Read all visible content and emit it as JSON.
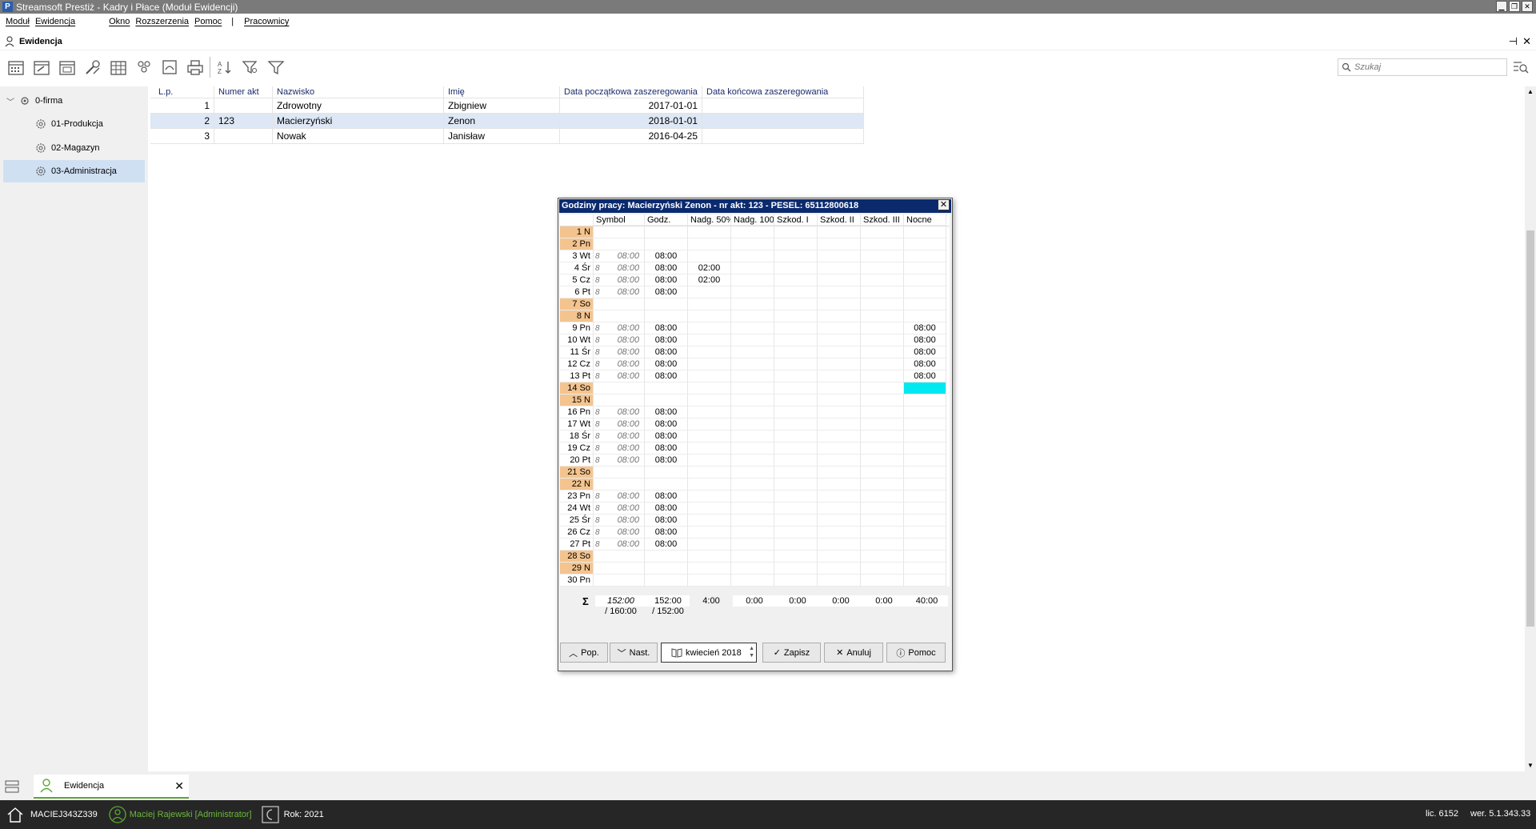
{
  "window": {
    "title": "Streamsoft Prestiż - Kadry i Płace (Moduł Ewidencji)",
    "app_icon": "P"
  },
  "menu": [
    "Moduł",
    "Ewidencja",
    "Okno",
    "Rozszerzenia",
    "Pomoc",
    "|",
    "Pracownicy"
  ],
  "section": {
    "title": "Ewidencja"
  },
  "search": {
    "placeholder": "Szukaj"
  },
  "tree": [
    {
      "label": "0-firma"
    },
    {
      "label": "01-Produkcja"
    },
    {
      "label": "02-Magazyn"
    },
    {
      "label": "03-Administracja",
      "selected": true
    }
  ],
  "grid": {
    "columns": [
      "L.p.",
      "Numer akt",
      "Nazwisko",
      "Imię",
      "Data początkowa zaszeregowania",
      "Data końcowa zaszeregowania"
    ],
    "rows": [
      {
        "lp": "1",
        "akt": "",
        "nazwisko": "Zdrowotny",
        "imie": "Zbigniew",
        "dp": "2017-01-01",
        "dk": ""
      },
      {
        "lp": "2",
        "akt": "123",
        "nazwisko": "Macierzyński",
        "imie": "Zenon",
        "dp": "2018-01-01",
        "dk": ""
      },
      {
        "lp": "3",
        "akt": "",
        "nazwisko": "Nowak",
        "imie": "Janisław",
        "dp": "2016-04-25",
        "dk": ""
      }
    ]
  },
  "dialog": {
    "title": "Godziny pracy: Macierzyński Zenon - nr akt: 123 - PESEL: 65112800618",
    "columns": [
      "Symbol",
      "Godz.",
      "Nadg. 50%",
      "Nadg. 100",
      "Szkod. I",
      "Szkod. II",
      "Szkod. III",
      "Nocne"
    ],
    "days": [
      {
        "day": "1 N",
        "weekend": true
      },
      {
        "day": "2 Pn",
        "weekend": true
      },
      {
        "day": "3 Wt",
        "sym": "8",
        "plan": "08:00",
        "godz": "08:00"
      },
      {
        "day": "4 Śr",
        "sym": "8",
        "plan": "08:00",
        "godz": "08:00",
        "n50": "02:00"
      },
      {
        "day": "5 Cz",
        "sym": "8",
        "plan": "08:00",
        "godz": "08:00",
        "n50": "02:00"
      },
      {
        "day": "6 Pt",
        "sym": "8",
        "plan": "08:00",
        "godz": "08:00"
      },
      {
        "day": "7 So",
        "weekend": true
      },
      {
        "day": "8 N",
        "weekend": true
      },
      {
        "day": "9 Pn",
        "sym": "8",
        "plan": "08:00",
        "godz": "08:00",
        "noc": "08:00"
      },
      {
        "day": "10 Wt",
        "sym": "8",
        "plan": "08:00",
        "godz": "08:00",
        "noc": "08:00"
      },
      {
        "day": "11 Śr",
        "sym": "8",
        "plan": "08:00",
        "godz": "08:00",
        "noc": "08:00"
      },
      {
        "day": "12 Cz",
        "sym": "8",
        "plan": "08:00",
        "godz": "08:00",
        "noc": "08:00"
      },
      {
        "day": "13 Pt",
        "sym": "8",
        "plan": "08:00",
        "godz": "08:00",
        "noc": "08:00"
      },
      {
        "day": "14 So",
        "weekend": true,
        "highlight_noc": true
      },
      {
        "day": "15 N",
        "weekend": true
      },
      {
        "day": "16 Pn",
        "sym": "8",
        "plan": "08:00",
        "godz": "08:00"
      },
      {
        "day": "17 Wt",
        "sym": "8",
        "plan": "08:00",
        "godz": "08:00"
      },
      {
        "day": "18 Śr",
        "sym": "8",
        "plan": "08:00",
        "godz": "08:00"
      },
      {
        "day": "19 Cz",
        "sym": "8",
        "plan": "08:00",
        "godz": "08:00"
      },
      {
        "day": "20 Pt",
        "sym": "8",
        "plan": "08:00",
        "godz": "08:00"
      },
      {
        "day": "21 So",
        "weekend": true
      },
      {
        "day": "22 N",
        "weekend": true
      },
      {
        "day": "23 Pn",
        "sym": "8",
        "plan": "08:00",
        "godz": "08:00"
      },
      {
        "day": "24 Wt",
        "sym": "8",
        "plan": "08:00",
        "godz": "08:00"
      },
      {
        "day": "25 Śr",
        "sym": "8",
        "plan": "08:00",
        "godz": "08:00"
      },
      {
        "day": "26 Cz",
        "sym": "8",
        "plan": "08:00",
        "godz": "08:00"
      },
      {
        "day": "27 Pt",
        "sym": "8",
        "plan": "08:00",
        "godz": "08:00"
      },
      {
        "day": "28 So",
        "weekend": true
      },
      {
        "day": "29 N",
        "weekend": true
      },
      {
        "day": "30 Pn"
      }
    ],
    "sums": {
      "sigma": "Σ",
      "plan": "152:00",
      "plan_of": "/ 160:00",
      "godz": "152:00",
      "godz_of": "/ 152:00",
      "n50": "4:00",
      "n100": "0:00",
      "s1": "0:00",
      "s2": "0:00",
      "s3": "0:00",
      "noc": "40:00"
    },
    "buttons": {
      "prev": "Pop.",
      "next": "Nast.",
      "month": "kwiecień 2018",
      "save": "Zapisz",
      "cancel": "Anuluj",
      "help": "Pomoc"
    },
    "accent_color": "#0b2a6e",
    "weekend_color": "#f4c48f",
    "highlight_color": "#00e8f0"
  },
  "tabbar": {
    "tab_label": "Ewidencja"
  },
  "statusbar": {
    "machine": "MACIEJ343Z339",
    "user": "Maciej Rajewski [Administrator]",
    "year": "Rok: 2021",
    "license": "lic. 6152",
    "version": "wer. 5.1.343.33"
  }
}
